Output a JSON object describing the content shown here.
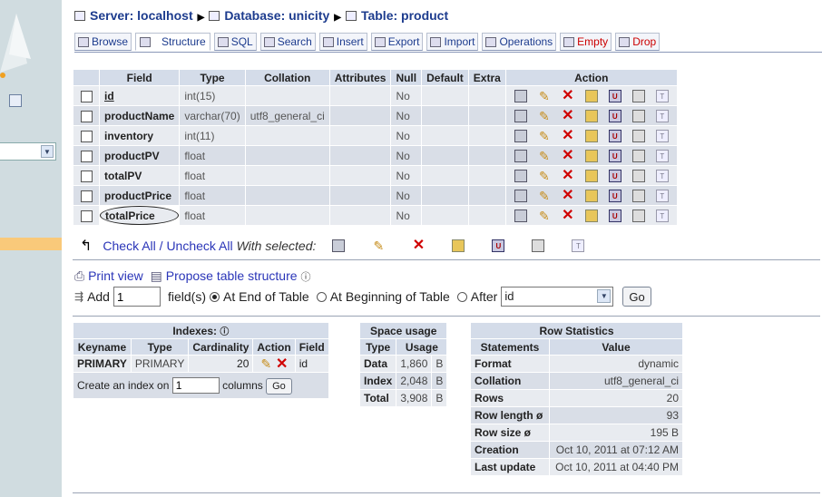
{
  "breadcrumb": {
    "server": "Server: localhost",
    "database": "Database: unicity",
    "table": "Table: product"
  },
  "tabs": [
    {
      "label": "Browse"
    },
    {
      "label": "Structure"
    },
    {
      "label": "SQL"
    },
    {
      "label": "Search"
    },
    {
      "label": "Insert"
    },
    {
      "label": "Export"
    },
    {
      "label": "Import"
    },
    {
      "label": "Operations"
    },
    {
      "label": "Empty"
    },
    {
      "label": "Drop"
    }
  ],
  "structure": {
    "headers": [
      "Field",
      "Type",
      "Collation",
      "Attributes",
      "Null",
      "Default",
      "Extra",
      "Action"
    ],
    "rows": [
      {
        "field": "id",
        "type": "int(15)",
        "collation": "",
        "attributes": "",
        "null": "No",
        "default": "",
        "extra": ""
      },
      {
        "field": "productName",
        "type": "varchar(70)",
        "collation": "utf8_general_ci",
        "attributes": "",
        "null": "No",
        "default": "",
        "extra": ""
      },
      {
        "field": "inventory",
        "type": "int(11)",
        "collation": "",
        "attributes": "",
        "null": "No",
        "default": "",
        "extra": ""
      },
      {
        "field": "productPV",
        "type": "float",
        "collation": "",
        "attributes": "",
        "null": "No",
        "default": "",
        "extra": ""
      },
      {
        "field": "totalPV",
        "type": "float",
        "collation": "",
        "attributes": "",
        "null": "No",
        "default": "",
        "extra": ""
      },
      {
        "field": "productPrice",
        "type": "float",
        "collation": "",
        "attributes": "",
        "null": "No",
        "default": "",
        "extra": ""
      },
      {
        "field": "totalPrice",
        "type": "float",
        "collation": "",
        "attributes": "",
        "null": "No",
        "default": "",
        "extra": ""
      }
    ]
  },
  "check": {
    "check_all": "Check All",
    "slash": " / ",
    "uncheck_all": "Uncheck All",
    "with_selected": "With selected:"
  },
  "links": {
    "print_view": "Print view",
    "propose": "Propose table structure"
  },
  "add_field": {
    "add": "Add",
    "count": "1",
    "fields_label": "field(s)",
    "at_end": "At End of Table",
    "at_beginning": "At Beginning of Table",
    "after": "After",
    "after_value": "id",
    "go": "Go"
  },
  "indexes": {
    "title": "Indexes:",
    "headers": [
      "Keyname",
      "Type",
      "Cardinality",
      "Action",
      "Field"
    ],
    "row": {
      "keyname": "PRIMARY",
      "type": "PRIMARY",
      "cardinality": "20",
      "field": "id"
    },
    "create_label": "Create an index on",
    "create_value": "1",
    "columns_label": "columns",
    "go": "Go"
  },
  "space_usage": {
    "title": "Space usage",
    "headers": [
      "Type",
      "Usage"
    ],
    "rows": [
      {
        "type": "Data",
        "value": "1,860",
        "unit": "B"
      },
      {
        "type": "Index",
        "value": "2,048",
        "unit": "B"
      },
      {
        "type": "Total",
        "value": "3,908",
        "unit": "B"
      }
    ]
  },
  "row_stats": {
    "title": "Row Statistics",
    "headers": [
      "Statements",
      "Value"
    ],
    "rows": [
      {
        "statement": "Format",
        "value": "dynamic"
      },
      {
        "statement": "Collation",
        "value": "utf8_general_ci"
      },
      {
        "statement": "Rows",
        "value": "20"
      },
      {
        "statement": "Row length ø",
        "value": "93"
      },
      {
        "statement": "Row size ø",
        "value": "195 B"
      },
      {
        "statement": "Creation",
        "value": "Oct 10, 2011 at 07:12 AM"
      },
      {
        "statement": "Last update",
        "value": "Oct 10, 2011 at 04:40 PM"
      }
    ]
  }
}
